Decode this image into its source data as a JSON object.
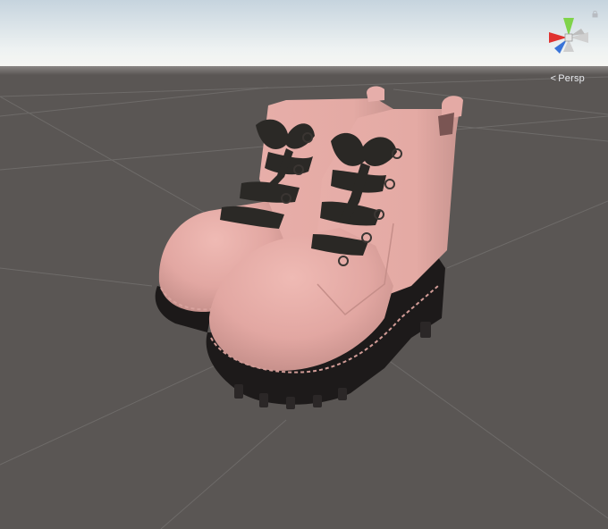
{
  "viewport": {
    "projection_label": "Persp",
    "projection_chevron": "<"
  },
  "colors": {
    "sky_top": "#c9d6df",
    "sky_bottom": "#f4f6f4",
    "ground": "#5a5654",
    "grid": "#6d6a68",
    "boot_pink": "#e2a7a2",
    "boot_pink_shadow": "#b97f7a",
    "sole": "#1d1a1a",
    "laces": "#2c2a27",
    "stitch": "#cf9a95",
    "gizmo_y": "#7fd34a",
    "gizmo_x": "#e0322f",
    "gizmo_z": "#3a74d8",
    "gizmo_neutral": "#c8c8c8",
    "label_text": "#e8eaee"
  },
  "icons": {
    "orientation_gizmo": "axis-gizmo-icon",
    "lock": "lock-icon"
  }
}
